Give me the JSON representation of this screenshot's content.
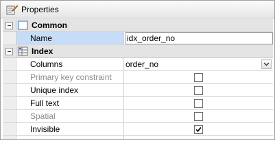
{
  "panel": {
    "title": "Properties",
    "title_icon": "properties-icon"
  },
  "categories": [
    {
      "label": "Common",
      "expanded": true,
      "icon": "common-category-icon",
      "properties": [
        {
          "name": "Name",
          "value": "idx_order_no",
          "editor": "text",
          "selected": true
        }
      ]
    },
    {
      "label": "Index",
      "expanded": true,
      "icon": "index-category-icon",
      "properties": [
        {
          "name": "Columns",
          "value": "order_no",
          "editor": "combo"
        },
        {
          "name": "Primary key constraint",
          "checked": false,
          "disabled": true,
          "editor": "checkbox"
        },
        {
          "name": "Unique index",
          "checked": false,
          "editor": "checkbox"
        },
        {
          "name": "Full text",
          "checked": false,
          "editor": "checkbox"
        },
        {
          "name": "Spatial",
          "checked": false,
          "disabled": true,
          "editor": "checkbox"
        },
        {
          "name": "Invisible",
          "checked": true,
          "editor": "checkbox"
        }
      ]
    }
  ],
  "colors": {
    "selected_row": "#c7dcf6",
    "disabled_text": "#8c8c8c",
    "category_bg": "#e4e4e4"
  }
}
